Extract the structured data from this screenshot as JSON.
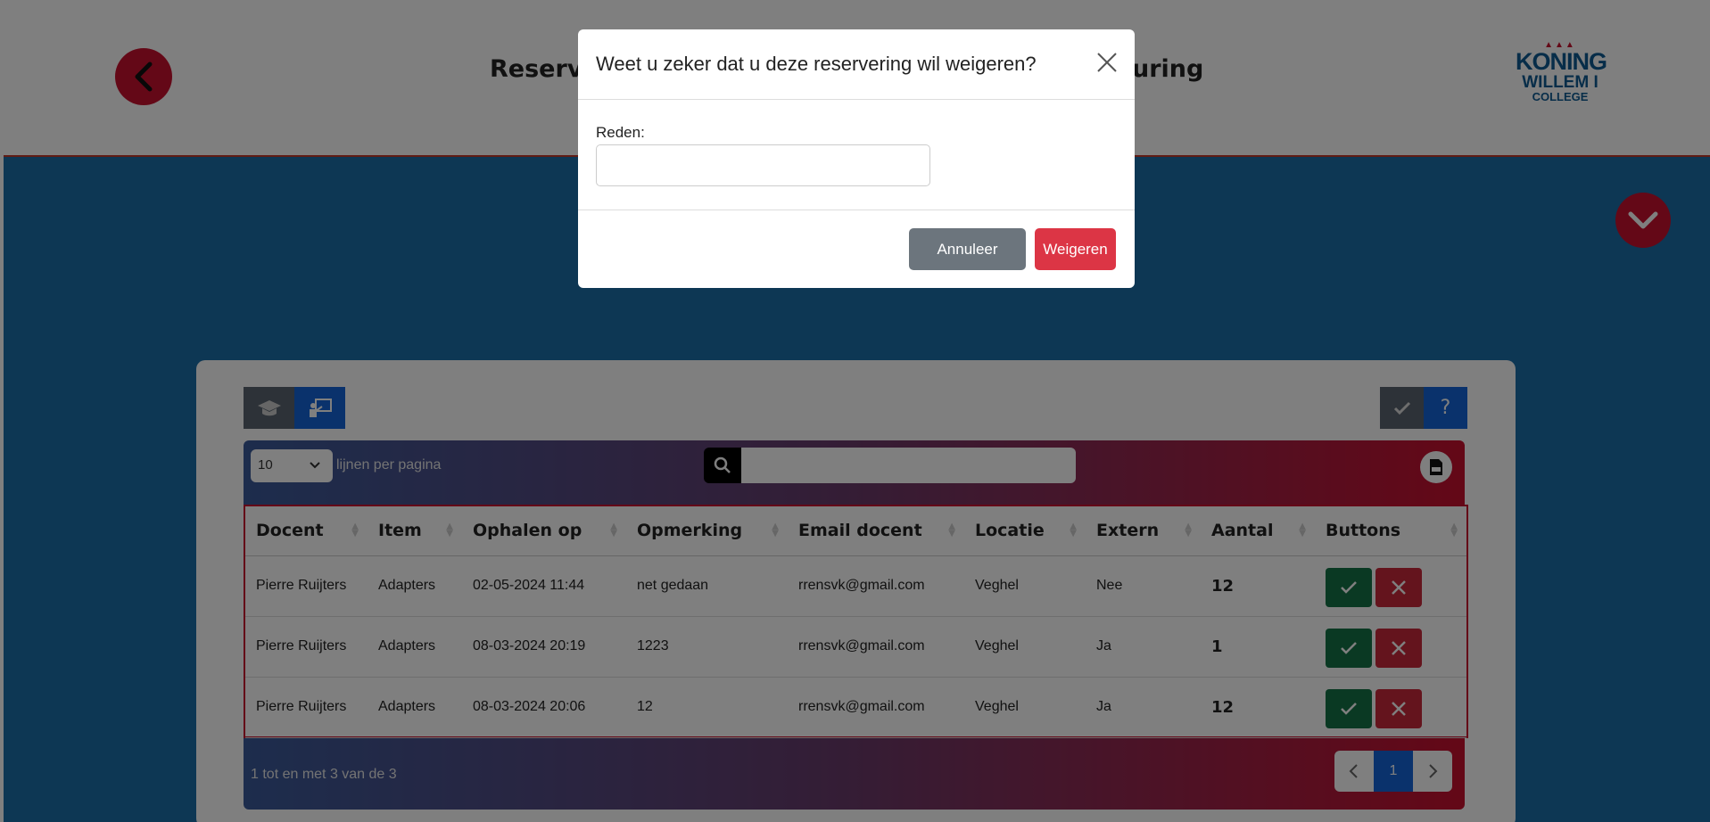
{
  "header": {
    "title_left": "Reserve",
    "title_right": "uring",
    "logo": {
      "crown": "▲▲▲",
      "line1": "KONING",
      "line2": "WILLEM I",
      "line3": "COLLEGE"
    }
  },
  "toolbar": {
    "page_length": "10",
    "page_length_label": "lijnen per pagina",
    "help_label": "?"
  },
  "table": {
    "columns": [
      "Docent",
      "Item",
      "Ophalen op",
      "Opmerking",
      "Email docent",
      "Locatie",
      "Extern",
      "Aantal",
      "Buttons"
    ],
    "rows": [
      {
        "docent": "Pierre Ruijters",
        "item": "Adapters",
        "ophalen_op": "02-05-2024 11:44",
        "opmerking": "net gedaan",
        "email": "rrensvk@gmail.com",
        "locatie": "Veghel",
        "extern": "Nee",
        "aantal": "12"
      },
      {
        "docent": "Pierre Ruijters",
        "item": "Adapters",
        "ophalen_op": "08-03-2024 20:19",
        "opmerking": "1223",
        "email": "rrensvk@gmail.com",
        "locatie": "Veghel",
        "extern": "Ja",
        "aantal": "1"
      },
      {
        "docent": "Pierre Ruijters",
        "item": "Adapters",
        "ophalen_op": "08-03-2024 20:06",
        "opmerking": "12",
        "email": "rrensvk@gmail.com",
        "locatie": "Veghel",
        "extern": "Ja",
        "aantal": "12"
      }
    ]
  },
  "footer": {
    "info": "1 tot en met 3 van de 3",
    "current_page": "1"
  },
  "modal": {
    "title": "Weet u zeker dat u deze reservering wil weigeren?",
    "reason_label": "Reden:",
    "reason_value": "",
    "cancel_label": "Annuleer",
    "refuse_label": "Weigeren"
  },
  "colors": {
    "brand_red": "#c8102e",
    "brand_blue": "#1a6fa8",
    "accept_green": "#157347",
    "refuse_red": "#dc3545",
    "cancel_grey": "#6c757d"
  },
  "icons": [
    "back-arrow-icon",
    "chevron-down-icon",
    "graduation-cap-icon",
    "teacher-board-icon",
    "check-icon",
    "question-icon",
    "search-icon",
    "pdf-icon",
    "close-icon",
    "chevron-left-icon",
    "chevron-right-icon"
  ]
}
